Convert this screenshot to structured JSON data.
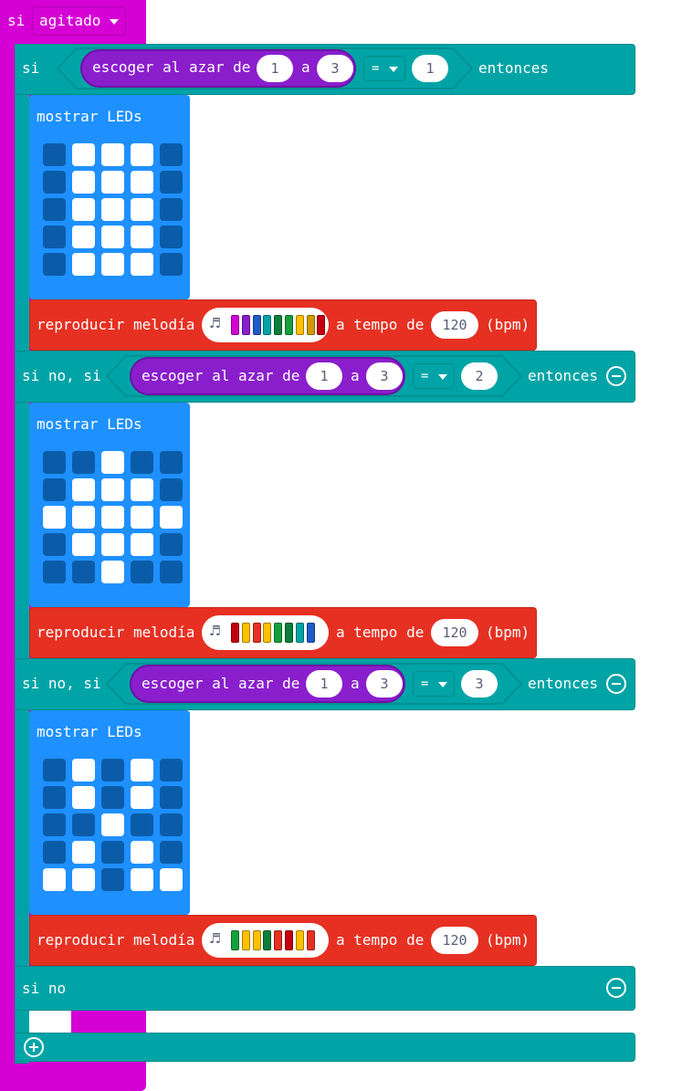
{
  "hat": {
    "label": "si",
    "dropdown_value": "agitado"
  },
  "if_block": {
    "if_label": "si",
    "then_label": "entonces",
    "else_if_label": "si no, si",
    "else_label": "si no"
  },
  "random": {
    "label": "escoger al azar de",
    "to_label": "a"
  },
  "comparison_operator": "=",
  "branches": [
    {
      "random_from": "1",
      "random_to": "3",
      "compare_value": "1",
      "show_leds_label": "mostrar LEDs",
      "leds": [
        [
          0,
          1,
          1,
          1,
          0
        ],
        [
          0,
          1,
          1,
          1,
          0
        ],
        [
          0,
          1,
          1,
          1,
          0
        ],
        [
          0,
          1,
          1,
          1,
          0
        ],
        [
          0,
          1,
          1,
          1,
          0
        ]
      ],
      "melody_label": "reproducir melodía",
      "melody_colors": [
        "#d400d4",
        "#8a1ecc",
        "#1e5cc8",
        "#00a4a6",
        "#0a7f3a",
        "#13a03c",
        "#ffc000",
        "#d29a00",
        "#c4000f"
      ],
      "tempo_label": "a tempo de",
      "tempo_value": "120",
      "bpm_label": "(bpm)"
    },
    {
      "random_from": "1",
      "random_to": "3",
      "compare_value": "2",
      "show_leds_label": "mostrar LEDs",
      "leds": [
        [
          0,
          0,
          1,
          0,
          0
        ],
        [
          0,
          1,
          1,
          1,
          0
        ],
        [
          1,
          1,
          1,
          1,
          1
        ],
        [
          0,
          1,
          1,
          1,
          0
        ],
        [
          0,
          0,
          1,
          0,
          0
        ]
      ],
      "melody_label": "reproducir melodía",
      "melody_colors": [
        "#c4000f",
        "#ffc000",
        "#e63022",
        "#ffc000",
        "#13a03c",
        "#0a7f3a",
        "#00a4a6",
        "#1e5cc8"
      ],
      "tempo_label": "a tempo de",
      "tempo_value": "120",
      "bpm_label": "(bpm)"
    },
    {
      "random_from": "1",
      "random_to": "3",
      "compare_value": "3",
      "show_leds_label": "mostrar LEDs",
      "leds": [
        [
          0,
          1,
          0,
          1,
          0
        ],
        [
          0,
          1,
          0,
          1,
          0
        ],
        [
          0,
          0,
          1,
          0,
          0
        ],
        [
          0,
          1,
          0,
          1,
          0
        ],
        [
          1,
          1,
          0,
          1,
          1
        ]
      ],
      "melody_label": "reproducir melodía",
      "melody_colors": [
        "#13a03c",
        "#ffc000",
        "#ffc000",
        "#0a7f3a",
        "#e63022",
        "#c4000f",
        "#ffc000",
        "#e63022"
      ],
      "tempo_label": "a tempo de",
      "tempo_value": "120",
      "bpm_label": "(bpm)"
    }
  ],
  "icons": {
    "dropdown": "caret-down-icon",
    "remove": "minus-circle-icon",
    "add": "plus-circle-icon",
    "melody": "music-note-icon"
  }
}
